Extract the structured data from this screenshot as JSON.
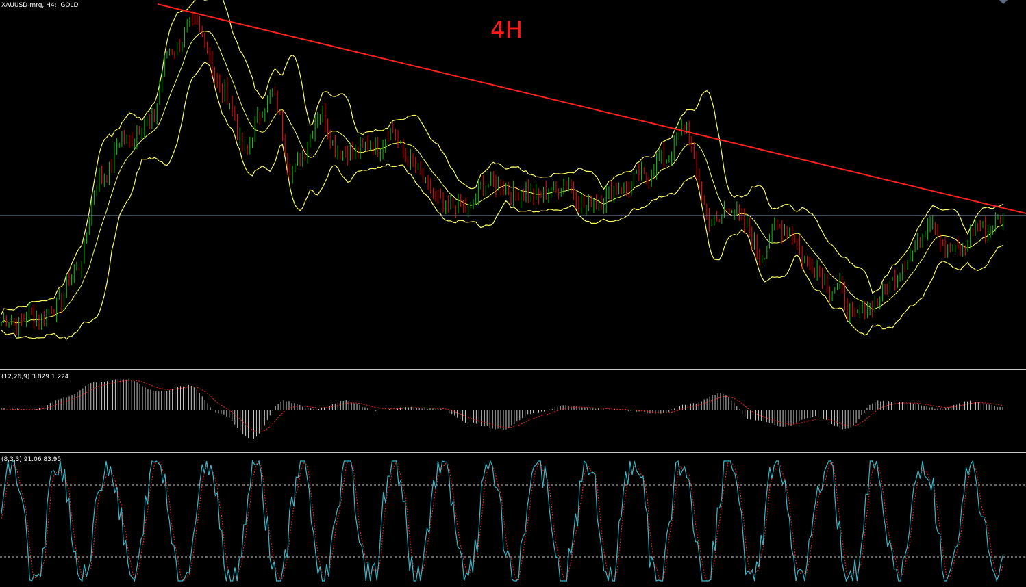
{
  "header": {
    "symbol_label": "XAUUSD-mrg, H4:  GOLD",
    "timeframe_annotation": "4H"
  },
  "macd": {
    "label": "(12,26,9) 3.829 1.224"
  },
  "stochastic": {
    "label": "(8,3,3) 91.06 83.95"
  },
  "colors": {
    "background": "#000000",
    "bull_candle": "#00cc00",
    "bear_candle": "#ff0000",
    "bollinger_band": "#ffff66",
    "trendline": "#ff2020",
    "horizontal_line": "#8c96b4",
    "macd_histogram": "#c8c8c8",
    "macd_signal": "#ff2020",
    "stoch_main": "#33bbcc",
    "stoch_signal": "#ff2020",
    "stoch_levels": "#c8c8c8",
    "timeframe_text": "#ff1a1a"
  },
  "chart_data": [
    {
      "type": "candlestick",
      "title": "XAUUSD-mrg, H4:  GOLD",
      "annotation": "4H",
      "overlays": [
        "bollinger_bands",
        "trendline",
        "horizontal_line"
      ],
      "grid": false,
      "price_path_approx": [
        0.1,
        0.11,
        0.13,
        0.24,
        0.52,
        0.64,
        0.69,
        0.92,
        0.99,
        0.8,
        0.62,
        0.78,
        0.55,
        0.72,
        0.6,
        0.62,
        0.66,
        0.55,
        0.45,
        0.44,
        0.52,
        0.49,
        0.48,
        0.51,
        0.45,
        0.49,
        0.52,
        0.58,
        0.67,
        0.4,
        0.44,
        0.31,
        0.39,
        0.28,
        0.21,
        0.12,
        0.18,
        0.28,
        0.4,
        0.3,
        0.38,
        0.4
      ]
    },
    {
      "type": "bar",
      "name": "MACD",
      "label": "(12,26,9) 3.829 1.224",
      "values": [
        0.05,
        0.02,
        0.4,
        0.9,
        1.0,
        0.6,
        0.8,
        -0.1,
        -0.9,
        0.3,
        0.05,
        0.3,
        0.0,
        0.1,
        0.05,
        -0.4,
        -0.6,
        -0.1,
        0.15,
        0.05,
        0.0,
        -0.1,
        0.2,
        0.55,
        -0.3,
        -0.5,
        -0.2,
        -0.6,
        0.3,
        0.25,
        0.05,
        0.3,
        0.1
      ]
    },
    {
      "type": "line",
      "name": "Stochastic",
      "label": "(8,3,3) 91.06 83.95",
      "ylim": [
        0,
        100
      ],
      "levels": [
        80,
        20
      ]
    }
  ]
}
